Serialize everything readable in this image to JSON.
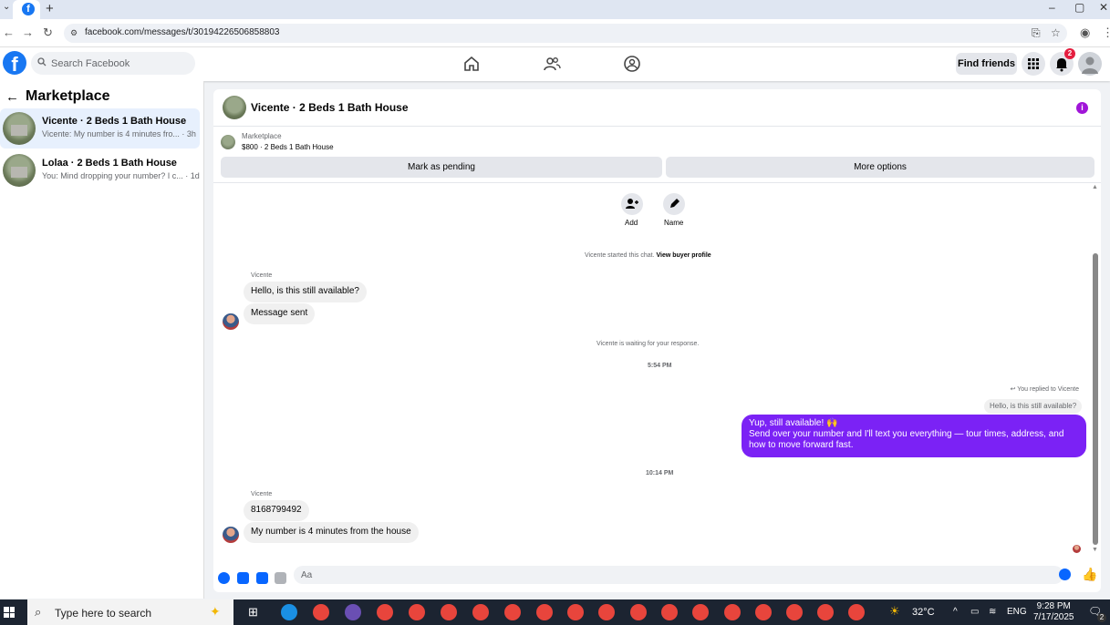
{
  "browser": {
    "url": "facebook.com/messages/t/30194226506858803",
    "new_tab": "+"
  },
  "fb_header": {
    "logo": "f",
    "search_placeholder": "Search Facebook",
    "find_friends": "Find friends",
    "notification_count": "2",
    "icons": [
      "home-icon",
      "friends-icon",
      "groups-icon",
      "menu-grid-icon",
      "bell-icon",
      "account-avatar"
    ]
  },
  "sidebar": {
    "title": "Marketplace",
    "conversations": [
      {
        "name": "Vicente · 2 Beds 1 Bath House",
        "snippet": "Vicente: My number is 4 minutes fro... · 3h",
        "active": true
      },
      {
        "name": "Lolaa · 2 Beds 1 Bath House",
        "snippet": "You: Mind dropping your number? I c... · 1d",
        "active": false
      }
    ]
  },
  "chat": {
    "title": "Vicente · 2 Beds 1 Bath House",
    "listing_category": "Marketplace",
    "listing_price": "$800 · 2 Beds 1 Bath House",
    "mark_pending": "Mark as pending",
    "more_options": "More options",
    "quick_actions": {
      "add": "Add",
      "name": "Name"
    },
    "started_text": "Vicente started this chat.",
    "view_profile": "View buyer profile",
    "waiting_text": "Vicente is waiting for your response.",
    "messages": {
      "sender_1": "Vicente",
      "msg_1": "Hello, is this still available?",
      "msg_2": "Message sent",
      "time_1": "5:54 PM",
      "replied_label": "You replied to Vicente",
      "quoted": "Hello, is this still available?",
      "mine_line1": "Yup, still available! 🙌",
      "mine_line2": "Send over your number and I'll text you everything — tour times, address, and how to move forward fast.",
      "time_2": "10:14 PM",
      "sender_2": "Vicente",
      "msg_3": "8168799492",
      "msg_4": "My number is 4 minutes from the house"
    },
    "composer_placeholder": "Aa"
  },
  "taskbar": {
    "search_text": "Type here to search",
    "weather": "32°C",
    "lang": "ENG",
    "time": "9:28 PM",
    "date": "7/17/2025",
    "notif_count": "2"
  },
  "colors": {
    "fb_blue": "#1877f2",
    "my_bubble": "#7b22f5",
    "info_purple": "#a015d8"
  }
}
